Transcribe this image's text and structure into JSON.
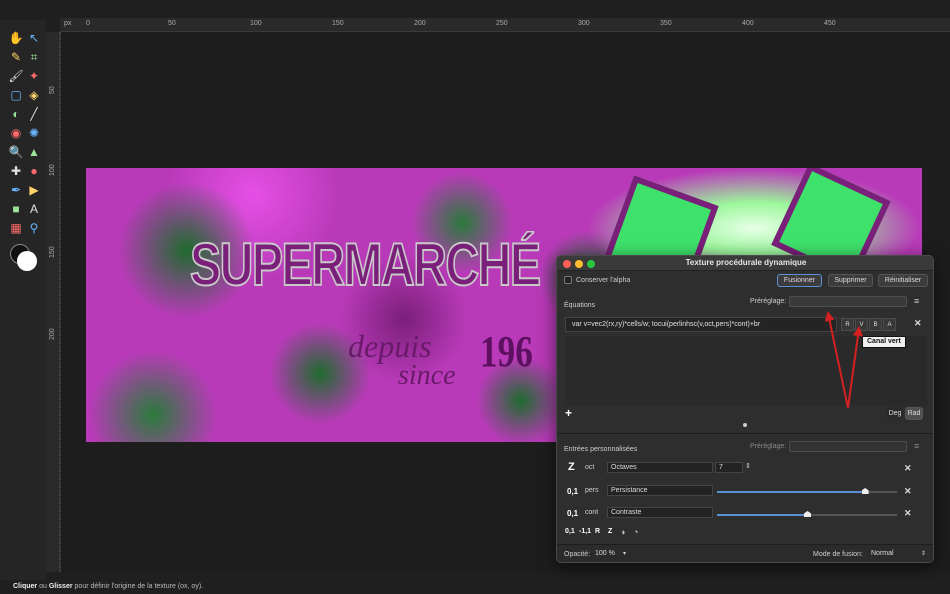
{
  "toolbar": {
    "tools": [
      {
        "name": "hand-tool-icon",
        "glyph": "✋"
      },
      {
        "name": "move-tool-icon",
        "glyph": "↖"
      },
      {
        "name": "color-picker-icon",
        "glyph": "✎"
      },
      {
        "name": "crop-tool-icon",
        "glyph": "⌗"
      },
      {
        "name": "paint-brush-icon",
        "glyph": "🖌"
      },
      {
        "name": "magic-wand-icon",
        "glyph": "✦"
      },
      {
        "name": "marquee-tool-icon",
        "glyph": "▢"
      },
      {
        "name": "fill-bucket-icon",
        "glyph": "◈"
      },
      {
        "name": "gradient-tool-icon",
        "glyph": "◐"
      },
      {
        "name": "brush-tool-icon",
        "glyph": "╱"
      },
      {
        "name": "dodge-tool-icon",
        "glyph": "◉"
      },
      {
        "name": "clone-tool-icon",
        "glyph": "✺"
      },
      {
        "name": "zoom-tool-icon",
        "glyph": "🔍"
      },
      {
        "name": "stamp-tool-icon",
        "glyph": "▲"
      },
      {
        "name": "healing-tool-icon",
        "glyph": "✚"
      },
      {
        "name": "blur-tool-icon",
        "glyph": "●"
      },
      {
        "name": "pen-tool-icon",
        "glyph": "✒"
      },
      {
        "name": "node-tool-icon",
        "glyph": "▶"
      },
      {
        "name": "shape-tool-icon",
        "glyph": "■"
      },
      {
        "name": "text-tool-icon",
        "glyph": "A"
      },
      {
        "name": "mesh-tool-icon",
        "glyph": "▦"
      },
      {
        "name": "view-tool-icon",
        "glyph": "⚲"
      }
    ]
  },
  "rulers": {
    "unit": "px",
    "top_ticks": [
      "0",
      "50",
      "100",
      "150",
      "200",
      "250",
      "300",
      "350",
      "400",
      "450"
    ],
    "left_ticks": [
      "50",
      "100",
      "150",
      "200"
    ]
  },
  "artwork": {
    "title": "SUPERMARCHÉ",
    "depuis": "depuis",
    "since": "since",
    "year": "196"
  },
  "dialog": {
    "title": "Texture procédurale dynamique",
    "conserve_alpha_label": "Conserver l'alpha",
    "buttons": {
      "merge": "Fusionner",
      "delete": "Supprimer",
      "reset": "Réinitialiser"
    },
    "equations_label": "Équations",
    "preset_label": "Préréglage:",
    "equation_value": "var v=vec2(rx,ry)*cells/w; tocui(perlinhsc(v,oct,pers)*cont)+br",
    "channels": [
      "R",
      "V",
      "B",
      "A"
    ],
    "tooltip": "Canal vert",
    "deg_label": "Deg",
    "rad_label": "Rad",
    "custom_inputs_label": "Entrées personnalisées",
    "custom_preset_label": "Préréglage:",
    "inputs": [
      {
        "icon": "Z",
        "tag": "oct",
        "name": "Octaves",
        "value": "7"
      },
      {
        "icon": "0,1",
        "tag": "pers",
        "name": "Persistance",
        "slider": 0.82
      },
      {
        "icon": "0,1",
        "tag": "cont",
        "name": "Contraste",
        "slider": 0.5
      }
    ],
    "add_types": [
      "0,1",
      "-1,1",
      "R",
      "Z"
    ],
    "opacity_label": "Opacité:",
    "opacity_value": "100 %",
    "blend_label": "Mode de fusion:",
    "blend_value": "Normal"
  },
  "status": {
    "click": "Cliquer",
    "or": "ou",
    "drag": "Glisser",
    "rest": "pour définir l'origine de la texture (ox, oy)."
  },
  "colors": {
    "annotation_arrow": "#d42020",
    "slider_accent": "#5b8fd6"
  }
}
